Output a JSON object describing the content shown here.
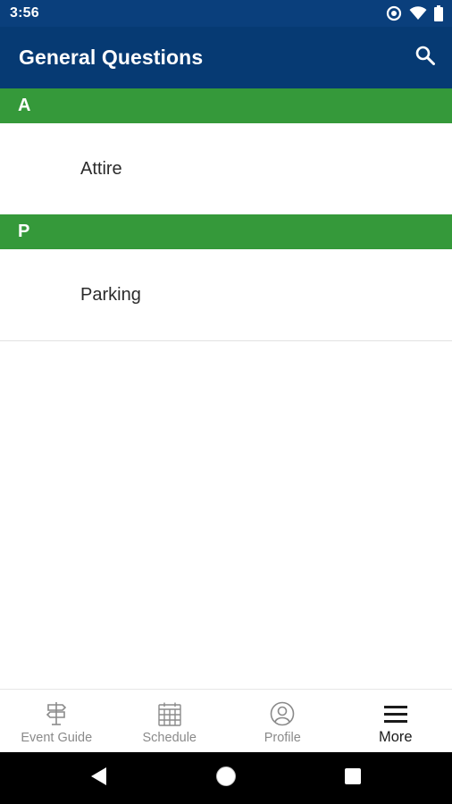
{
  "status_bar": {
    "time": "3:56",
    "icons": [
      "data-saver-icon",
      "wifi-icon",
      "battery-icon"
    ]
  },
  "app_bar": {
    "title": "General Questions",
    "search_icon": "search-icon"
  },
  "sections": [
    {
      "letter": "A",
      "items": [
        "Attire"
      ]
    },
    {
      "letter": "P",
      "items": [
        "Parking"
      ]
    }
  ],
  "bottom_nav": {
    "items": [
      {
        "label": "Event Guide",
        "icon": "signpost-icon",
        "active": false
      },
      {
        "label": "Schedule",
        "icon": "calendar-icon",
        "active": false
      },
      {
        "label": "Profile",
        "icon": "profile-icon",
        "active": false
      },
      {
        "label": "More",
        "icon": "menu-icon",
        "active": true
      }
    ]
  },
  "colors": {
    "status_bar": "#0a3f7c",
    "app_bar": "#063a73",
    "section_header": "#35993a",
    "nav_inactive": "#8a8a8a",
    "nav_active": "#1b1b1b"
  }
}
